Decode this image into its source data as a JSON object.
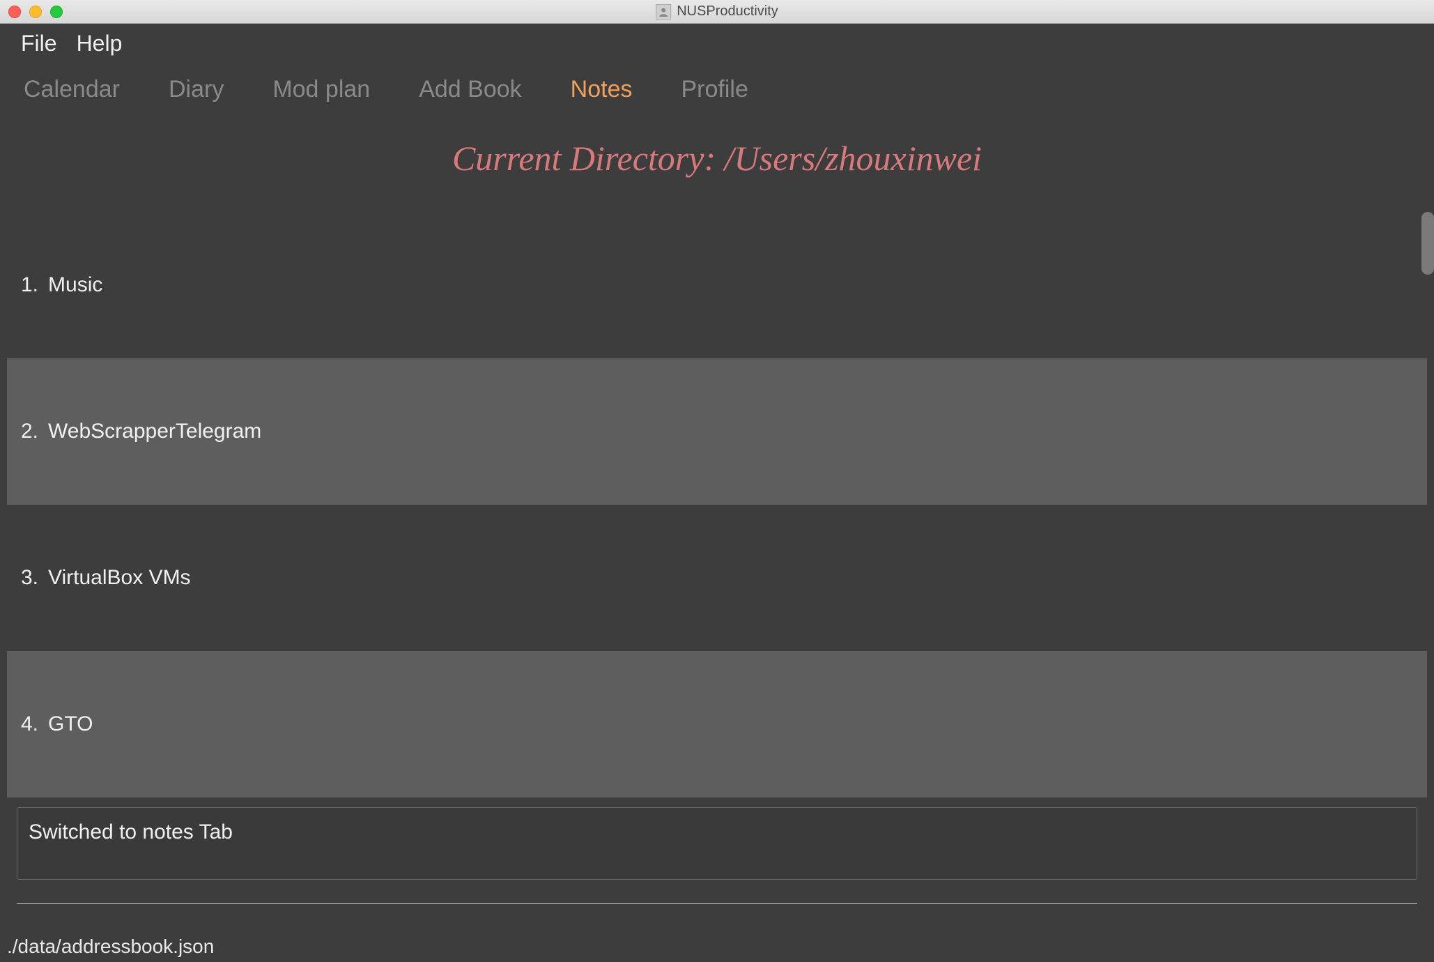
{
  "window": {
    "title": "NUSProductivity"
  },
  "menubar": {
    "items": [
      "File",
      "Help"
    ]
  },
  "tabs": {
    "items": [
      {
        "label": "Calendar",
        "active": false
      },
      {
        "label": "Diary",
        "active": false
      },
      {
        "label": "Mod plan",
        "active": false
      },
      {
        "label": "Add Book",
        "active": false
      },
      {
        "label": "Notes",
        "active": true
      },
      {
        "label": "Profile",
        "active": false
      }
    ]
  },
  "directory": {
    "label_prefix": "Current Directory: ",
    "path": "/Users/zhouxinwei"
  },
  "notes": {
    "items": [
      {
        "index": "1.",
        "name": "Music"
      },
      {
        "index": "2.",
        "name": "WebScrapperTelegram"
      },
      {
        "index": "3.",
        "name": "VirtualBox VMs"
      },
      {
        "index": "4.",
        "name": "GTO"
      }
    ]
  },
  "status": {
    "message": "Switched to notes Tab"
  },
  "footer": {
    "path": "./data/addressbook.json"
  }
}
